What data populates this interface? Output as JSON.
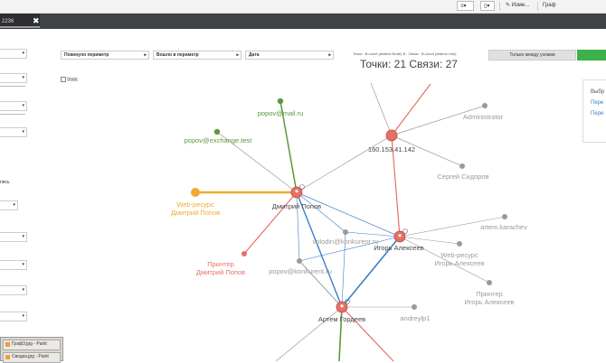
{
  "toolbar": {
    "menu_glyph": "≡",
    "doc_glyph": "▯",
    "edit_label": "Изме...",
    "graph_label": "Граф"
  },
  "tab": {
    "label": "2236",
    "close": "✖"
  },
  "sidebar": {
    "label_1": "пись"
  },
  "filters": {
    "outside": "Покинуло периметр",
    "inside": "Вошло в периметр",
    "date": "Дата"
  },
  "static_label": "Static",
  "stats": {
    "small": "Точки : B-count (distinct Node) B : Связи : B-count (distinct Link)",
    "big": "Точки: 21 Связи: 27"
  },
  "buttons": {
    "between_nodes": "Только между узлами"
  },
  "right_panel": {
    "title": "Выбр",
    "link1": "Пере",
    "link2": "Пере"
  },
  "taskbar": {
    "item1": "Граф3.jpg - Paint",
    "item2": "Сводка.jpg - Paint"
  },
  "colors": {
    "person": "#e57067",
    "email": "#5a9a3c",
    "web": "#eeaa33",
    "gray": "#9a9a9a",
    "blue": "#3a7ec6",
    "green_button": "#3db24a"
  },
  "graph": {
    "nodes": [
      {
        "id": "popov_mail",
        "label": "popov@mail.ru",
        "type": "email"
      },
      {
        "id": "popov_exch",
        "label": "popov@exchange.test",
        "type": "email"
      },
      {
        "id": "web_popov",
        "label": "Web-ресурс\nДмитрий Попов",
        "type": "web"
      },
      {
        "id": "dpopov",
        "label": "Дмитрий Попов",
        "type": "person"
      },
      {
        "id": "printer_popov",
        "label": "Принтер\nДмитрий Попов",
        "type": "printer"
      },
      {
        "id": "ip",
        "label": "160.153.41.142",
        "type": "ip"
      },
      {
        "id": "admin",
        "label": "Administrator",
        "type": "gray"
      },
      {
        "id": "sidorov",
        "label": "Сергей Сидоров",
        "type": "gray"
      },
      {
        "id": "volodin",
        "label": "volodin@konkurent.ru",
        "type": "gray"
      },
      {
        "id": "ialekseev",
        "label": "Игорь Алексеев",
        "type": "person"
      },
      {
        "id": "karachev",
        "label": "artem.karachev",
        "type": "gray"
      },
      {
        "id": "web_alekseev",
        "label": "Web-ресурс\nИгорь Алексеев",
        "type": "gray"
      },
      {
        "id": "popov_konk",
        "label": "popov@konkurent.ru",
        "type": "gray"
      },
      {
        "id": "printer_alekseev",
        "label": "Принтер\nИгорь Алексеев",
        "type": "gray"
      },
      {
        "id": "andreylp1",
        "label": "andreylp1",
        "type": "gray"
      },
      {
        "id": "gordeev",
        "label": "Артем Гордеев",
        "type": "person"
      },
      {
        "id": "out1",
        "label": "",
        "type": "gray"
      },
      {
        "id": "out2",
        "label": "",
        "type": "gray"
      },
      {
        "id": "out3",
        "label": "",
        "type": "gray"
      },
      {
        "id": "out4",
        "label": "",
        "type": "gray"
      },
      {
        "id": "out5",
        "label": "",
        "type": "gray"
      }
    ],
    "edges": [
      {
        "a": "dpopov",
        "b": "popov_mail",
        "color": "email",
        "w": 1.5
      },
      {
        "a": "dpopov",
        "b": "popov_exch",
        "color": "gray",
        "w": 0.7
      },
      {
        "a": "dpopov",
        "b": "web_popov",
        "color": "web",
        "w": 2.5
      },
      {
        "a": "dpopov",
        "b": "printer_popov",
        "color": "person",
        "w": 1.2
      },
      {
        "a": "dpopov",
        "b": "ip",
        "color": "gray",
        "w": 0.7
      },
      {
        "a": "dpopov",
        "b": "ialekseev",
        "color": "blue",
        "w": 0.7
      },
      {
        "a": "dpopov",
        "b": "gordeev",
        "color": "blue",
        "w": 1.4
      },
      {
        "a": "dpopov",
        "b": "volodin",
        "color": "blue",
        "w": 0.6
      },
      {
        "a": "dpopov",
        "b": "popov_konk",
        "color": "blue",
        "w": 0.6
      },
      {
        "a": "ip",
        "b": "admin",
        "color": "gray",
        "w": 0.7
      },
      {
        "a": "ip",
        "b": "sidorov",
        "color": "gray",
        "w": 0.7
      },
      {
        "a": "ip",
        "b": "ialekseev",
        "color": "person",
        "w": 1.2
      },
      {
        "a": "ip",
        "b": "out1",
        "color": "person",
        "w": 1.2
      },
      {
        "a": "ip",
        "b": "out2",
        "color": "gray",
        "w": 0.7
      },
      {
        "a": "ialekseev",
        "b": "karachev",
        "color": "gray",
        "w": 0.6
      },
      {
        "a": "ialekseev",
        "b": "web_alekseev",
        "color": "gray",
        "w": 0.6
      },
      {
        "a": "ialekseev",
        "b": "printer_alekseev",
        "color": "gray",
        "w": 0.6
      },
      {
        "a": "ialekseev",
        "b": "volodin",
        "color": "blue",
        "w": 0.6
      },
      {
        "a": "ialekseev",
        "b": "popov_konk",
        "color": "blue",
        "w": 0.6
      },
      {
        "a": "ialekseev",
        "b": "gordeev",
        "color": "blue",
        "w": 1.6
      },
      {
        "a": "gordeev",
        "b": "popov_konk",
        "color": "blue",
        "w": 0.7
      },
      {
        "a": "gordeev",
        "b": "volodin",
        "color": "blue",
        "w": 0.6
      },
      {
        "a": "gordeev",
        "b": "andreylp1",
        "color": "gray",
        "w": 0.6
      },
      {
        "a": "gordeev",
        "b": "out3",
        "color": "email",
        "w": 1.6
      },
      {
        "a": "gordeev",
        "b": "out4",
        "color": "gray",
        "w": 0.7
      },
      {
        "a": "gordeev",
        "b": "out5",
        "color": "person",
        "w": 1.2
      },
      {
        "a": "gordeev",
        "b": "popov_konk",
        "color": "gray",
        "w": 0.6
      }
    ]
  }
}
